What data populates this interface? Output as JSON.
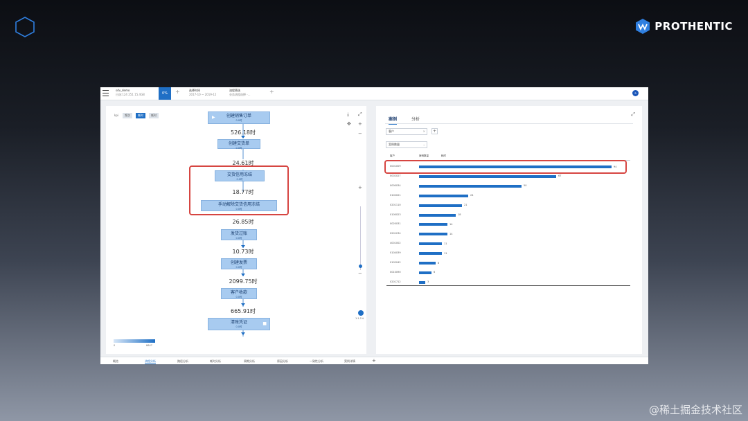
{
  "brand": {
    "name": "PROTHENTIC"
  },
  "watermark": "@稀土掘金技术社区",
  "topbar": {
    "dataset": {
      "title": "sdv_demo",
      "sub": "已选:124 251 15.4GB"
    },
    "progress": "0%",
    "range": {
      "title": "选择时间",
      "sub": "2017-10 ~ 2019-12"
    },
    "filter": {
      "title": "流程筛选",
      "sub": "业务流程选择 -..."
    },
    "avatar": "a"
  },
  "left": {
    "filter_label": "kpi",
    "filter_buttons": [
      "频次",
      "耗时",
      "耗时"
    ],
    "nodes": [
      {
        "label": "创建销售订单",
        "sub": "0.0时"
      },
      {
        "label": "创建交货单",
        "sub": "0.0时"
      },
      {
        "label": "交货信用冻结",
        "sub": "0.0时"
      },
      {
        "label": "手动解除交货信用冻结",
        "sub": "0.0时"
      },
      {
        "label": "发货过账",
        "sub": "0.0时"
      },
      {
        "label": "创建发票",
        "sub": "0.0时"
      },
      {
        "label": "客户收款",
        "sub": "0.0时"
      },
      {
        "label": "清账凭证",
        "sub": "0.0时"
      }
    ],
    "edges": [
      "526.18时",
      "24.61时",
      "18.77时",
      "26.85时",
      "10.73时",
      "2099.75时",
      "665.91时"
    ],
    "legend": {
      "min": "0",
      "max": "8647"
    },
    "zoom_label": "1:1.1%"
  },
  "right": {
    "tabs": [
      "案例",
      "分析"
    ],
    "select_primary": "客户",
    "select_secondary": "案例数量",
    "columns": [
      "客户",
      "案例数量",
      "耗时"
    ],
    "rows": [
      {
        "label": "0001009",
        "value": 94
      },
      {
        "label": "0002027",
        "value": 67
      },
      {
        "label": "0000034",
        "value": 50
      },
      {
        "label": "0102021",
        "value": 24
      },
      {
        "label": "0201110",
        "value": 21
      },
      {
        "label": "0100023",
        "value": 18
      },
      {
        "label": "0020031",
        "value": 14
      },
      {
        "label": "0201234",
        "value": 14
      },
      {
        "label": "4001002",
        "value": 11
      },
      {
        "label": "0104039",
        "value": 11
      },
      {
        "label": "0102042",
        "value": 8
      },
      {
        "label": "0010090",
        "value": 6
      },
      {
        "label": "0201712",
        "value": 3
      }
    ],
    "max_value": 94
  },
  "bottom": {
    "tabs": [
      "概览",
      "流程分析",
      "路径分析",
      "耗时分析",
      "周期分析",
      "原因分析",
      "一致性分析",
      "案例详情"
    ]
  }
}
